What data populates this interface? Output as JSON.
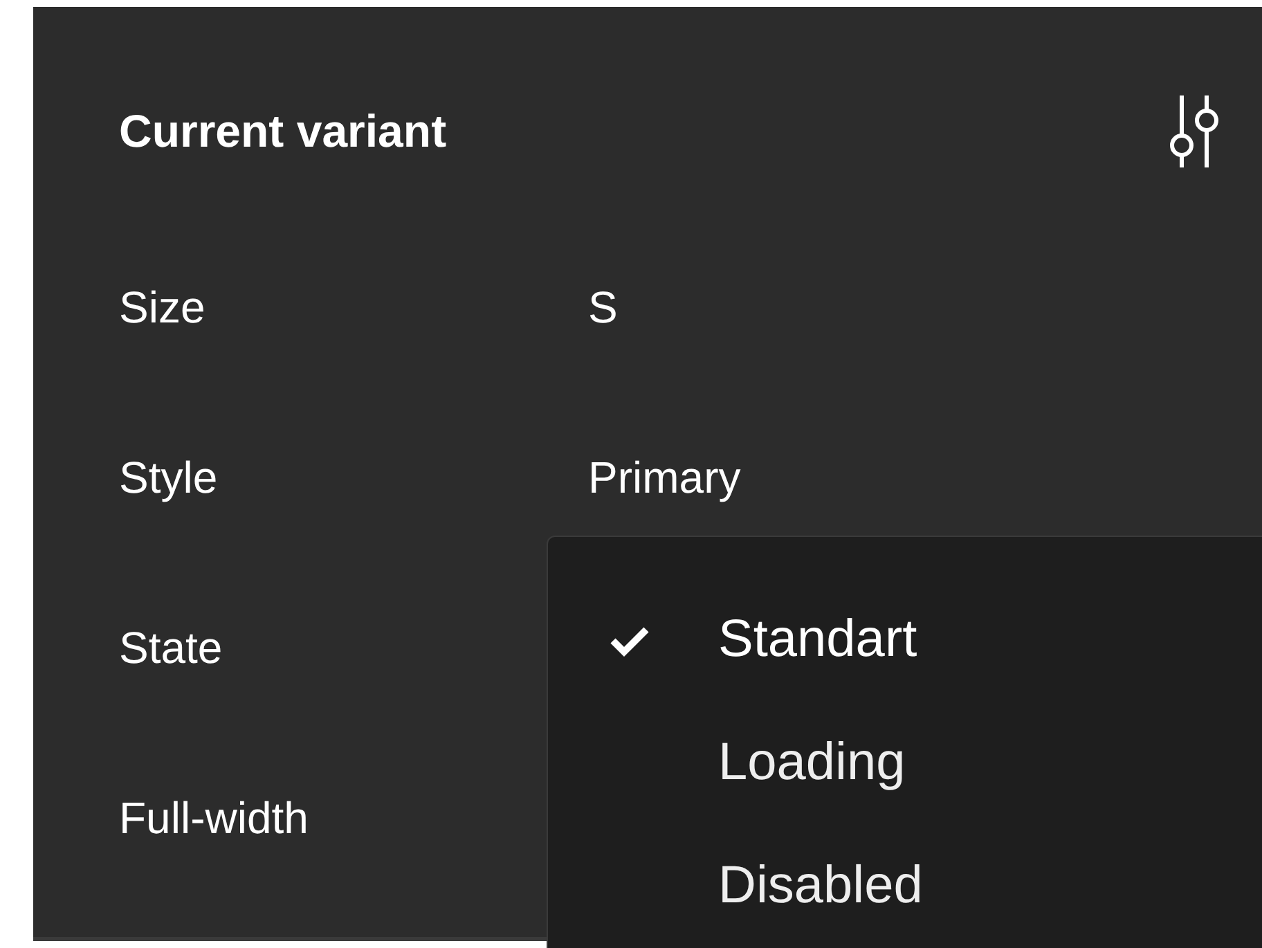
{
  "panel": {
    "title": "Current variant",
    "properties": [
      {
        "label": "Size",
        "value": "S"
      },
      {
        "label": "Style",
        "value": "Primary"
      },
      {
        "label": "State"
      },
      {
        "label": "Full-width"
      }
    ]
  },
  "dropdown": {
    "options": [
      {
        "label": "Standart",
        "selected": true
      },
      {
        "label": "Loading",
        "selected": false
      },
      {
        "label": "Disabled",
        "selected": false
      }
    ]
  }
}
